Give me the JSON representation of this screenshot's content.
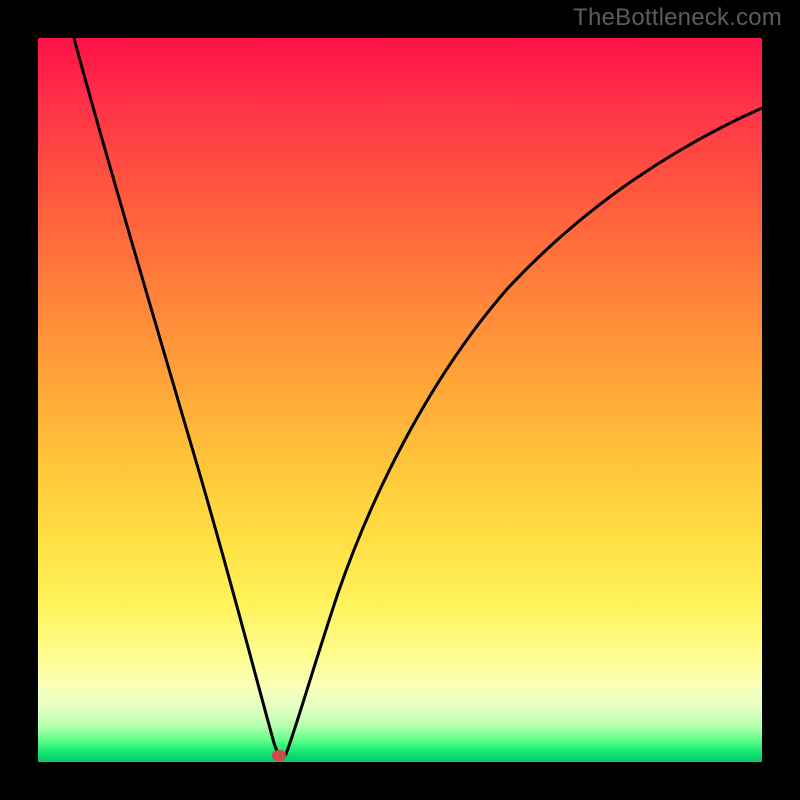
{
  "watermark": "TheBottleneck.com",
  "chart_data": {
    "type": "line",
    "title": "",
    "xlabel": "",
    "ylabel": "",
    "xlim": [
      0,
      100
    ],
    "ylim": [
      0,
      100
    ],
    "grid": false,
    "series": [
      {
        "name": "curve",
        "x": [
          5,
          8,
          12,
          16,
          20,
          24,
          28,
          31,
          33,
          34.5,
          36,
          38,
          41,
          45,
          50,
          56,
          63,
          72,
          82,
          92,
          100
        ],
        "values": [
          100,
          88,
          73,
          58,
          44,
          30,
          17,
          8,
          3,
          0.5,
          4,
          12,
          24,
          38,
          51,
          62,
          71,
          79,
          85,
          89,
          92
        ]
      }
    ],
    "marker": {
      "x": 34.5,
      "y": 0.5,
      "color": "#cf4a44"
    },
    "background_gradient": {
      "top": "#ff1246",
      "mid": "#ffc83a",
      "low": "#fffb84",
      "bottom": "#08c46a"
    }
  }
}
